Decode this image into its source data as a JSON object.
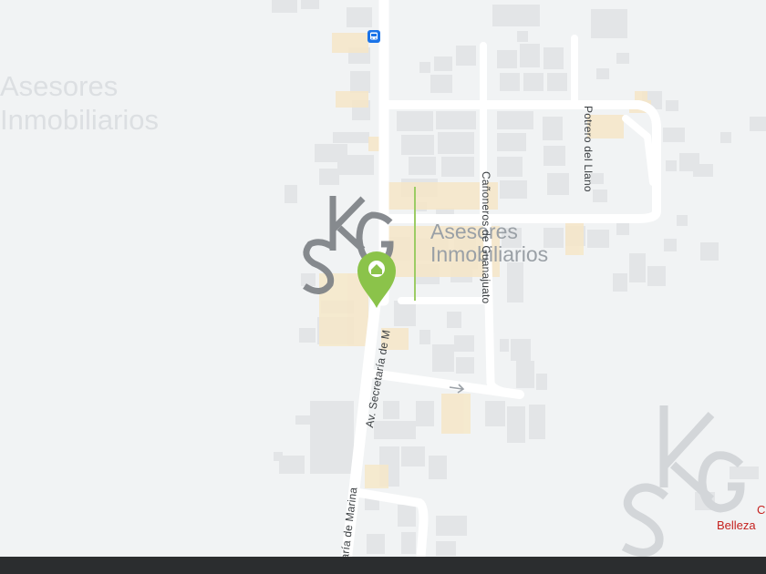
{
  "map": {
    "background_color": "#f1f3f4",
    "road_color": "#ffffff",
    "building_color": "#e3e5e7",
    "highlight_color": "#f6e7c8",
    "streets": [
      {
        "name": "Av. Secretaría de Marina",
        "visible_text": "Av. Secretaría de M"
      },
      {
        "name": "Secretaría de Marina",
        "visible_text": "retaría de Marina"
      },
      {
        "name": "Cañoneros de Guanajuato",
        "visible_text": "Cañoneros de Guanajuato"
      },
      {
        "name": "Potrero del Llano",
        "visible_text": "Potrero del Llano"
      }
    ],
    "transit_stop_icon": "bus-icon",
    "direction_arrow_icon": "one-way-arrow-icon"
  },
  "watermarks": {
    "top_left_line1": "Asesores",
    "top_left_line2": "Inmobiliarios",
    "center_line1": "Asesores",
    "center_line2": "Inmobiliarios",
    "logo_letters": "KGS"
  },
  "marker": {
    "color": "#8bc34a",
    "icon": "home-icon"
  },
  "poi": {
    "partial_letter": "C",
    "label": "Belleza"
  }
}
